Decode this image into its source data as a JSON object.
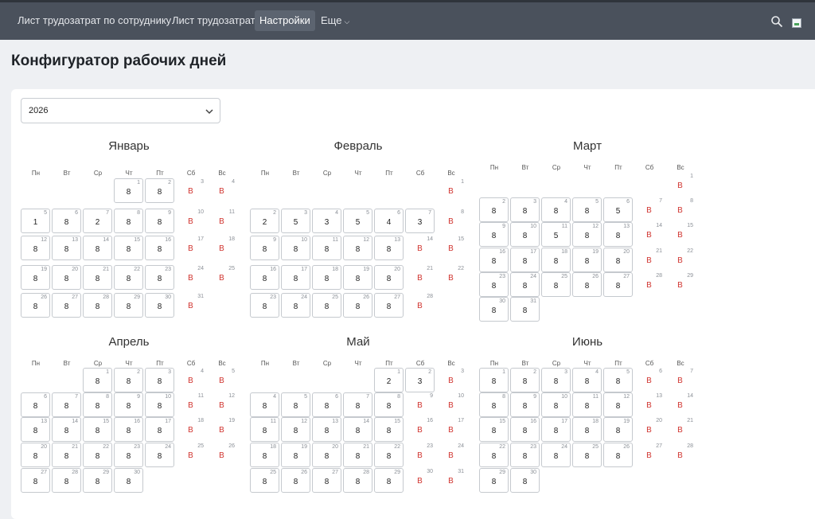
{
  "nav": {
    "items": [
      "Лист трудозатрат по сотруднику",
      "Лист трудозатрат",
      "Настройки",
      "Еще"
    ],
    "active": "Настройки",
    "more_caret": "⌵"
  },
  "icons": {
    "search": "search-icon",
    "avatar": "avatar-icon",
    "select": "chevron-down-icon"
  },
  "page": {
    "title": "Конфигуратор рабочих дней"
  },
  "year_select": {
    "value": "2026"
  },
  "weekdays": [
    "Пн",
    "Вт",
    "Ср",
    "Чт",
    "Пт",
    "Сб",
    "Вс"
  ],
  "colors": {
    "weekend": "#d0332e",
    "topbar": "#4a515c"
  },
  "months": [
    {
      "name": "Январь",
      "start": 3,
      "days": [
        "8",
        "8",
        "В",
        "В",
        "1",
        "8",
        "2",
        "8",
        "8",
        "В",
        "В",
        "8",
        "8",
        "8",
        "8",
        "8",
        "В",
        "В",
        "8",
        "8",
        "8",
        "8",
        "8",
        "В",
        "В",
        "8",
        "8",
        "8",
        "8",
        "8",
        "В"
      ]
    },
    {
      "name": "Февраль",
      "start": 6,
      "days": [
        "В",
        "2",
        "5",
        "3",
        "5",
        "4",
        "3",
        "В",
        "8",
        "8",
        "8",
        "8",
        "8",
        "В",
        "В",
        "8",
        "8",
        "8",
        "8",
        "8",
        "В",
        "В",
        "8",
        "8",
        "8",
        "8",
        "8",
        "В"
      ]
    },
    {
      "name": "Март",
      "start": 6,
      "days": [
        "В",
        "8",
        "8",
        "8",
        "8",
        "5",
        "В",
        "В",
        "8",
        "8",
        "5",
        "8",
        "8",
        "В",
        "В",
        "8",
        "8",
        "8",
        "8",
        "8",
        "В",
        "В",
        "8",
        "8",
        "8",
        "8",
        "8",
        "В",
        "В",
        "8",
        "8"
      ]
    },
    {
      "name": "Апрель",
      "start": 2,
      "days": [
        "8",
        "8",
        "8",
        "В",
        "В",
        "8",
        "8",
        "8",
        "8",
        "8",
        "В",
        "В",
        "8",
        "8",
        "8",
        "8",
        "8",
        "В",
        "В",
        "8",
        "8",
        "8",
        "8",
        "8",
        "В",
        "В",
        "8",
        "8",
        "8",
        "8"
      ]
    },
    {
      "name": "Май",
      "start": 4,
      "days": [
        "2",
        "3",
        "В",
        "8",
        "8",
        "8",
        "8",
        "8",
        "В",
        "В",
        "8",
        "8",
        "8",
        "8",
        "8",
        "В",
        "В",
        "8",
        "8",
        "8",
        "8",
        "8",
        "В",
        "В",
        "8",
        "8",
        "8",
        "8",
        "8",
        "В",
        "В"
      ]
    },
    {
      "name": "Июнь",
      "start": 0,
      "days": [
        "8",
        "8",
        "8",
        "8",
        "8",
        "В",
        "В",
        "8",
        "8",
        "8",
        "8",
        "8",
        "В",
        "В",
        "8",
        "8",
        "8",
        "8",
        "8",
        "В",
        "В",
        "8",
        "8",
        "8",
        "8",
        "8",
        "В",
        "В",
        "8",
        "8"
      ]
    }
  ]
}
